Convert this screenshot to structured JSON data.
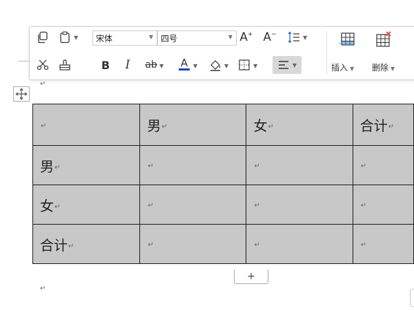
{
  "toolbar": {
    "font_name": "宋体",
    "font_size": "四号",
    "insert_label": "插入",
    "delete_label": "删除",
    "bold_glyph": "B",
    "italic_glyph": "I",
    "grow_font_glyph": "A",
    "shrink_font_glyph": "A",
    "font_color_glyph": "A",
    "font_color": "#1a3fd6",
    "strike_glyph": "ab",
    "active_bg": "#d8d8d8"
  },
  "table": {
    "rows": [
      [
        "",
        "男",
        "女",
        "合计"
      ],
      [
        "男",
        "",
        "",
        ""
      ],
      [
        "女",
        "",
        "",
        ""
      ],
      [
        "合计",
        "",
        "",
        ""
      ]
    ]
  },
  "paragraph_mark": "↵",
  "add_row_label": "+"
}
